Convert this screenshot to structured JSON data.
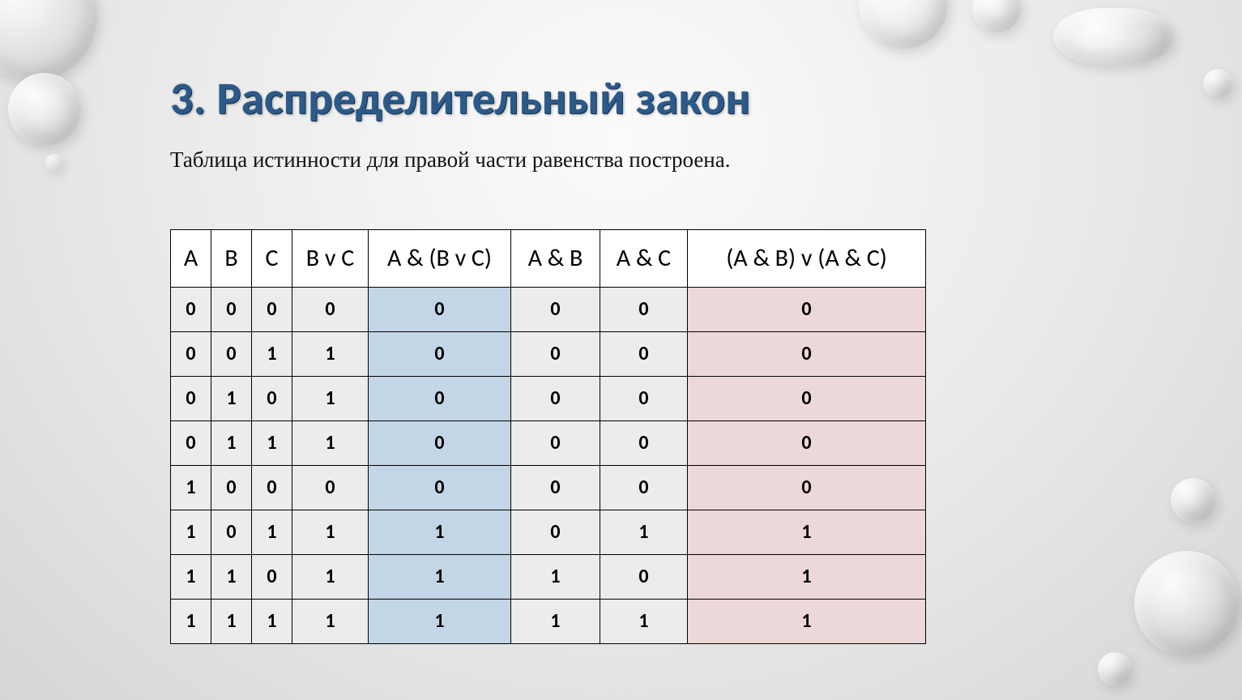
{
  "title": "3. Распределительный закон",
  "subtitle": "Таблица истинности для правой части равенства построена.",
  "chart_data": {
    "type": "table",
    "columns": [
      "A",
      "B",
      "C",
      "B v C",
      "A & (B v C)",
      "A & B",
      "A & C",
      "(A & B) v (A & C)"
    ],
    "highlight_columns": {
      "blue": 4,
      "pink": 7
    },
    "rows": [
      [
        0,
        0,
        0,
        0,
        0,
        0,
        0,
        0
      ],
      [
        0,
        0,
        1,
        1,
        0,
        0,
        0,
        0
      ],
      [
        0,
        1,
        0,
        1,
        0,
        0,
        0,
        0
      ],
      [
        0,
        1,
        1,
        1,
        0,
        0,
        0,
        0
      ],
      [
        1,
        0,
        0,
        0,
        0,
        0,
        0,
        0
      ],
      [
        1,
        0,
        1,
        1,
        1,
        0,
        1,
        1
      ],
      [
        1,
        1,
        0,
        1,
        1,
        1,
        0,
        1
      ],
      [
        1,
        1,
        1,
        1,
        1,
        1,
        1,
        1
      ]
    ]
  }
}
